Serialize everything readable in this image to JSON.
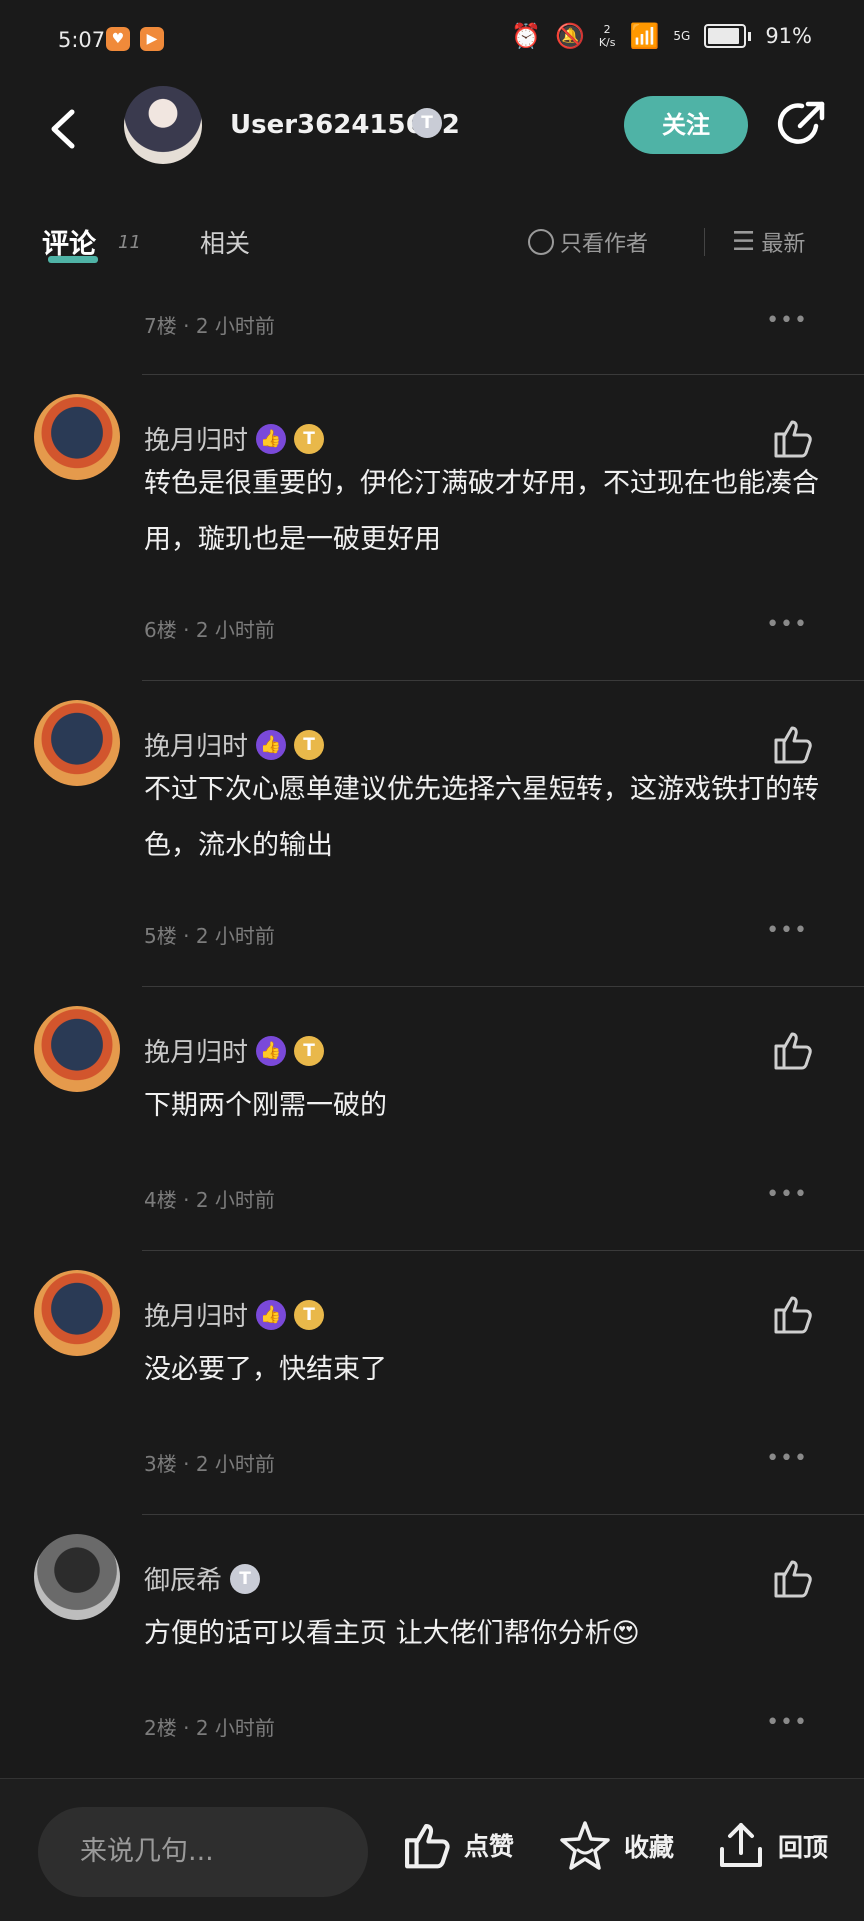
{
  "status_bar": {
    "time": "5:07",
    "net_speed_value": "2",
    "net_speed_unit": "K/s",
    "network": "5G",
    "battery": "91%"
  },
  "header": {
    "username": "User362415602",
    "badge_letter": "T",
    "follow_label": "关注"
  },
  "tabs": {
    "comments_label": "评论",
    "comments_count": "11",
    "related_label": "相关",
    "only_author_label": "只看作者",
    "sort_label": "最新"
  },
  "partial_meta": {
    "floor": "7楼",
    "time": "2 小时前"
  },
  "comments": [
    {
      "name": "挽月归时",
      "text": "转色是很重要的，伊伦汀满破才好用，不过现在也能凑合用，璇玑也是一破更好用",
      "floor": "6楼",
      "time": "2 小时前"
    },
    {
      "name": "挽月归时",
      "text": "不过下次心愿单建议优先选择六星短转，这游戏铁打的转色，流水的输出",
      "floor": "5楼",
      "time": "2 小时前"
    },
    {
      "name": "挽月归时",
      "text": "下期两个刚需一破的",
      "floor": "4楼",
      "time": "2 小时前"
    },
    {
      "name": "挽月归时",
      "text": "没必要了，快结束了",
      "floor": "3楼",
      "time": "2 小时前"
    },
    {
      "name": "御辰希",
      "text": "方便的话可以看主页 让大佬们帮你分析😍",
      "floor": "2楼",
      "time": "2 小时前"
    }
  ],
  "bottom_bar": {
    "input_placeholder": "来说几句...",
    "like_label": "点赞",
    "favorite_label": "收藏",
    "top_label": "回顶"
  },
  "colors": {
    "accent": "#4fb3a6",
    "background": "#1a1a1a"
  }
}
